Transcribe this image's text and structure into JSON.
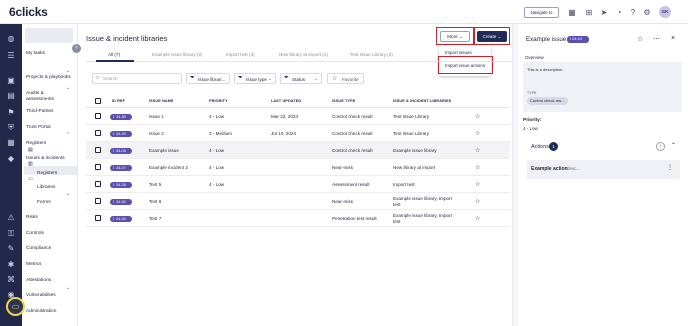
{
  "app": {
    "logo_main": "6clicks",
    "navigate_label": "Navigate to",
    "avatar_initials": "GK"
  },
  "sidebar": {
    "items": [
      {
        "label": "My tasks"
      },
      {
        "label": "Projects & playbooks"
      },
      {
        "label": "Audits & assessments"
      },
      {
        "label": "Third-Parties"
      },
      {
        "label": "Trust Portal"
      },
      {
        "label": "Registers"
      },
      {
        "label": "Issues & incidents"
      },
      {
        "label": "Registers"
      },
      {
        "label": "Libraries"
      },
      {
        "label": "Forms"
      },
      {
        "label": "Risks"
      },
      {
        "label": "Controls"
      },
      {
        "label": "Compliance"
      },
      {
        "label": "Metrics"
      },
      {
        "label": "Attestations"
      },
      {
        "label": "Vulnerabilities"
      },
      {
        "label": "Administration"
      }
    ]
  },
  "page": {
    "title": "Issue & incident libraries",
    "more_label": "More",
    "create_label": "Create"
  },
  "more_menu": {
    "items": [
      {
        "label": "Import issues"
      },
      {
        "label": "Import issue actions"
      }
    ]
  },
  "tabs": [
    {
      "label": "All (7)"
    },
    {
      "label": "Example issue library (2)"
    },
    {
      "label": "Import test (3)"
    },
    {
      "label": "New library at import (1)"
    },
    {
      "label": "Test Issue Library (2)"
    }
  ],
  "filters": {
    "search_placeholder": "Search",
    "issue_library": "Issue librari...",
    "issue_type": "Issue type",
    "status": "Status",
    "favorite": "Favorite"
  },
  "table": {
    "headers": {
      "id": "ID REF",
      "name": "ISSUE NAME",
      "priority": "PRIORITY",
      "updated": "LAST UPDATED",
      "type": "ISSUE TYPE",
      "library": "ISSUE & INCIDENT LIBRARIES"
    },
    "rows": [
      {
        "prefix": "I",
        "id": "24-30",
        "name": "Issue 1",
        "priority": "4 - Low",
        "updated": "Mar 22, 2024",
        "type": "Control check result",
        "library": "Test Issue Library"
      },
      {
        "prefix": "I",
        "id": "24-29",
        "name": "Issue 2",
        "priority": "3 - Medium",
        "updated": "Jul 10, 2024",
        "type": "Control check result",
        "library": "Test Issue Library"
      },
      {
        "prefix": "I",
        "id": "24-04",
        "name": "Example issue",
        "priority": "4 - Low",
        "updated": "",
        "type": "Control check result",
        "library": "Example issue library"
      },
      {
        "prefix": "I",
        "id": "24-07",
        "name": "Example incident 3",
        "priority": "4 - Low",
        "updated": "",
        "type": "Near-miss",
        "library": "New library at import"
      },
      {
        "prefix": "I",
        "id": "24-28",
        "name": "Test 5",
        "priority": "4 - Low",
        "updated": "",
        "type": "Assessment result",
        "library": "Import test"
      },
      {
        "prefix": "I",
        "id": "24-32",
        "name": "Test 6",
        "priority": "",
        "updated": "",
        "type": "Near-miss",
        "library": "Example issue library, Import test"
      },
      {
        "prefix": "I",
        "id": "24-34",
        "name": "Test 7",
        "priority": "",
        "updated": "",
        "type": "Penetration test result",
        "library": "Example issue library, Import test"
      }
    ]
  },
  "panel": {
    "title": "Example issue",
    "badge_prefix": "I",
    "badge_id": "24-04",
    "overview_label": "Overview",
    "description": "This is a description.",
    "type_label": "TYPE",
    "type_value": "Control check res...",
    "priority_label": "Priority:",
    "priority_value": "4 - Low",
    "actions_label": "Actions",
    "actions_count": "1",
    "action_name": "Example action",
    "action_desc": "desc..."
  }
}
